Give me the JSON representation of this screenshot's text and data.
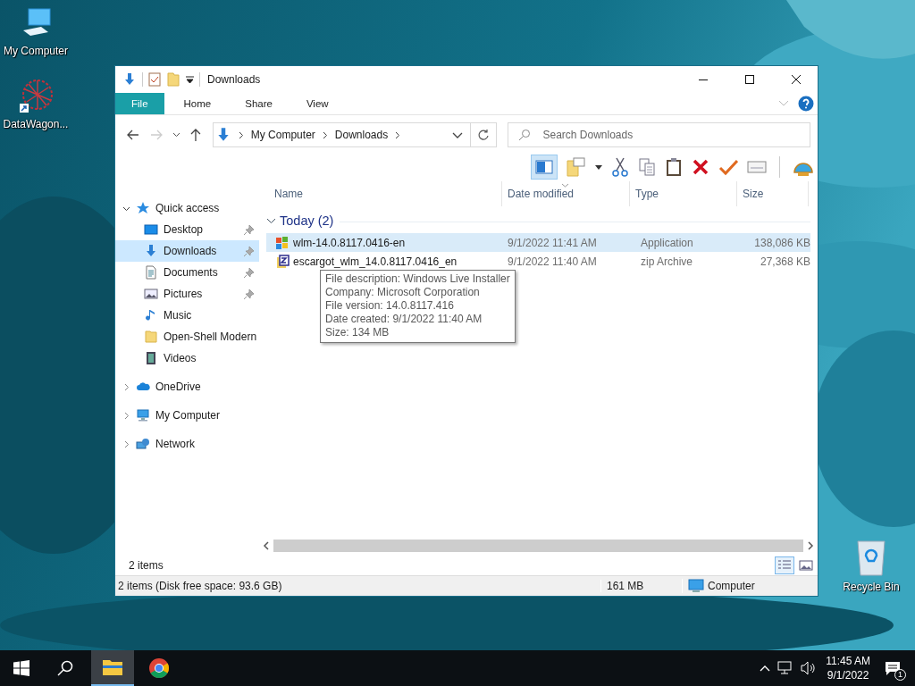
{
  "desktop_icons": [
    {
      "kind": "computer",
      "label": "My Computer"
    },
    {
      "kind": "shortcut",
      "label": "DataWagon..."
    }
  ],
  "recycle_bin": {
    "label": "Recycle Bin"
  },
  "window": {
    "title": "Downloads",
    "ribbon_tabs": [
      {
        "label": "File",
        "selected": true
      },
      {
        "label": "Home",
        "selected": false
      },
      {
        "label": "Share",
        "selected": false
      },
      {
        "label": "View",
        "selected": false
      }
    ],
    "address": [
      "My Computer",
      "Downloads"
    ],
    "search": {
      "placeholder": "Search Downloads"
    },
    "toolbar": {
      "pane_toggle_on": true
    },
    "nav_pane": [
      {
        "label": "Quick access",
        "kind": "star",
        "expanded": true,
        "selected": false,
        "children": [
          {
            "label": "Desktop",
            "kind": "desktop",
            "pinned": true,
            "selected": false
          },
          {
            "label": "Downloads",
            "kind": "download",
            "pinned": true,
            "selected": true
          },
          {
            "label": "Documents",
            "kind": "document",
            "pinned": true,
            "selected": false
          },
          {
            "label": "Pictures",
            "kind": "pictures",
            "pinned": true,
            "selected": false
          },
          {
            "label": "Music",
            "kind": "music",
            "pinned": false,
            "selected": false
          },
          {
            "label": "Open-Shell Modern",
            "kind": "folder",
            "pinned": false,
            "selected": false
          },
          {
            "label": "Videos",
            "kind": "videos",
            "pinned": false,
            "selected": false
          }
        ]
      },
      {
        "label": "OneDrive",
        "kind": "cloud",
        "expanded": false,
        "selected": false
      },
      {
        "label": "My Computer",
        "kind": "computer",
        "expanded": false,
        "selected": false
      },
      {
        "label": "Network",
        "kind": "network",
        "expanded": false,
        "selected": false
      }
    ],
    "columns": [
      "Name",
      "Date modified",
      "Type",
      "Size"
    ],
    "group": {
      "label": "Today (2)",
      "expanded": true
    },
    "files": [
      {
        "name": "wlm-14.0.8117.0416-en",
        "date_modified": "9/1/2022 11:41 AM",
        "type": "Application",
        "size": "138,086 KB",
        "kind": "app",
        "selected": true
      },
      {
        "name": "escargot_wlm_14.0.8117.0416_en",
        "date_modified": "9/1/2022 11:40 AM",
        "type": "zip Archive",
        "size": "27,368 KB",
        "kind": "zip",
        "selected": false
      }
    ],
    "tooltip": [
      "File description: Windows Live Installer",
      "Company: Microsoft Corporation",
      "File version: 14.0.8117.416",
      "Date created: 9/1/2022 11:40 AM",
      "Size: 134 MB"
    ],
    "item_count": "2 items",
    "views": [
      {
        "kind": "details",
        "selected": true
      },
      {
        "kind": "large",
        "selected": false
      }
    ],
    "status_bar": {
      "summary": "2 items (Disk free space: 93.6 GB)",
      "size": "161 MB",
      "location": "Computer"
    }
  },
  "taskbar": {
    "apps": [
      {
        "kind": "explorer",
        "active": true
      },
      {
        "kind": "chrome",
        "active": false
      }
    ],
    "time": "11:45 AM",
    "date": "9/1/2022",
    "notifications": "1"
  }
}
